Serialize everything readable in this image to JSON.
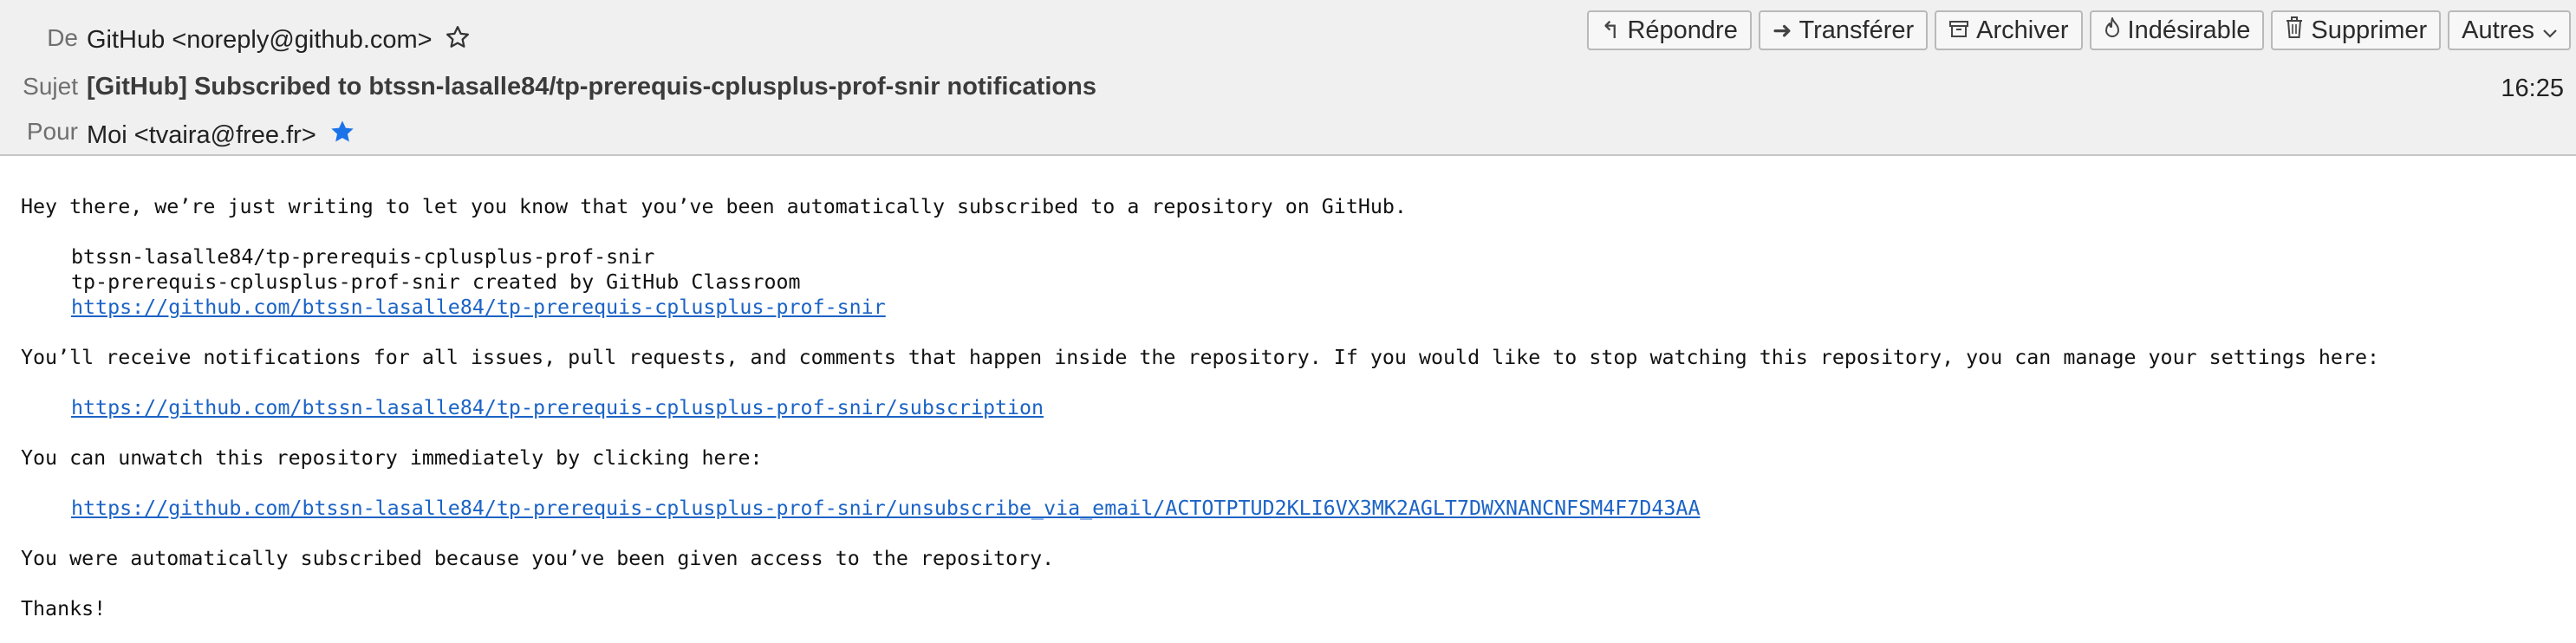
{
  "header": {
    "from_label": "De",
    "from_value": "GitHub <noreply@github.com>",
    "subject_label": "Sujet",
    "subject_value": "[GitHub] Subscribed to btssn-lasalle84/tp-prerequis-cplusplus-prof-snir notifications",
    "to_label": "Pour",
    "to_value": "Moi <tvaira@free.fr>",
    "time": "16:25"
  },
  "toolbar": {
    "reply": "Répondre",
    "forward": "Transférer",
    "archive": "Archiver",
    "junk": "Indésirable",
    "delete": "Supprimer",
    "more": "Autres"
  },
  "icons": {
    "from_star": "star-outline-icon",
    "to_star": "star-filled-icon",
    "reply": "reply-arrow-icon",
    "forward": "forward-arrow-icon",
    "archive": "archive-box-icon",
    "junk": "flame-icon",
    "delete": "trash-icon",
    "more": "chevron-down-icon"
  },
  "colors": {
    "header_bg": "#f0f0f0",
    "link": "#1b63c6",
    "star_filled": "#1a73e8"
  },
  "body": {
    "intro": "Hey there, we’re just writing to let you know that you’ve been automatically subscribed to a repository on GitHub.",
    "repo_name": "btssn-lasalle84/tp-prerequis-cplusplus-prof-snir",
    "repo_desc": "tp-prerequis-cplusplus-prof-snir created by GitHub Classroom",
    "repo_link": "https://github.com/btssn-lasalle84/tp-prerequis-cplusplus-prof-snir",
    "notify_text": "You’ll receive notifications for all issues, pull requests, and comments that happen inside the repository. If you would like to stop watching this repository, you can manage your settings here:",
    "subscription_link": "https://github.com/btssn-lasalle84/tp-prerequis-cplusplus-prof-snir/subscription",
    "unwatch_text": "You can unwatch this repository immediately by clicking here:",
    "unsubscribe_link": "https://github.com/btssn-lasalle84/tp-prerequis-cplusplus-prof-snir/unsubscribe_via_email/ACTOTPTUD2KLI6VX3MK2AGLT7DWXNANCNFSM4F7D43AA",
    "reason_text": "You were automatically subscribed because you’ve been given access to the repository.",
    "thanks": "Thanks!"
  }
}
